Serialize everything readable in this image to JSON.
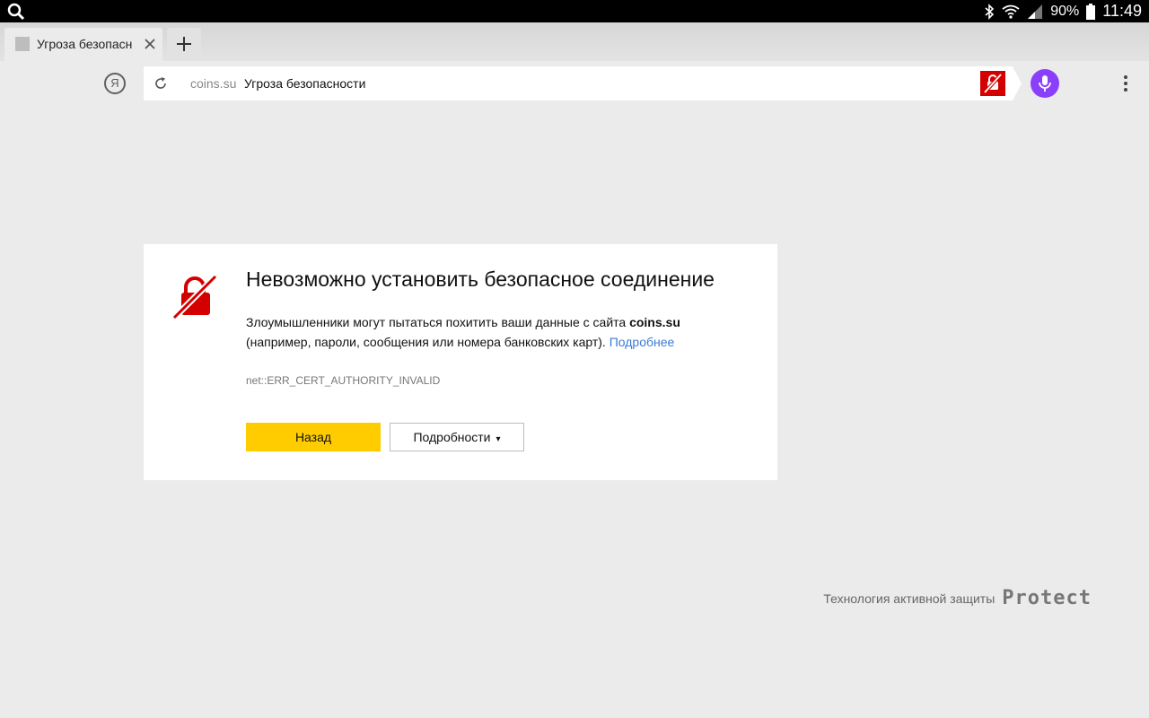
{
  "status_bar": {
    "battery": "90%",
    "time": "11:49"
  },
  "tabs": [
    {
      "title": "Угроза безопасн"
    }
  ],
  "omnibox": {
    "domain": "coins.su",
    "page_title": "Угроза безопасности"
  },
  "error": {
    "heading": "Невозможно установить безопасное соединение",
    "desc_part1": "Злоумышленники могут пытаться похитить ваши данные с сайта ",
    "site": "coins.su",
    "desc_part2": "(например, пароли, сообщения или номера банковских карт). ",
    "learn_more": "Подробнее",
    "code": "net::ERR_CERT_AUTHORITY_INVALID",
    "back_button": "Назад",
    "details_button": "Подробности",
    "details_caret": "▾"
  },
  "footer": {
    "text": "Технология активной защиты",
    "logo": "Protect"
  },
  "colors": {
    "accent_yellow": "#ffcc00",
    "danger_red": "#d40000",
    "alice_purple": "#8a3ffc",
    "link_blue": "#3a7bd5"
  },
  "icons": [
    "search-icon",
    "bluetooth-icon",
    "wifi-icon",
    "signal-icon",
    "battery-icon",
    "close-icon",
    "plus-icon",
    "yandex-icon",
    "reload-icon",
    "protect-warning-icon",
    "microphone-icon",
    "menu-dots-icon",
    "broken-lock-icon"
  ]
}
